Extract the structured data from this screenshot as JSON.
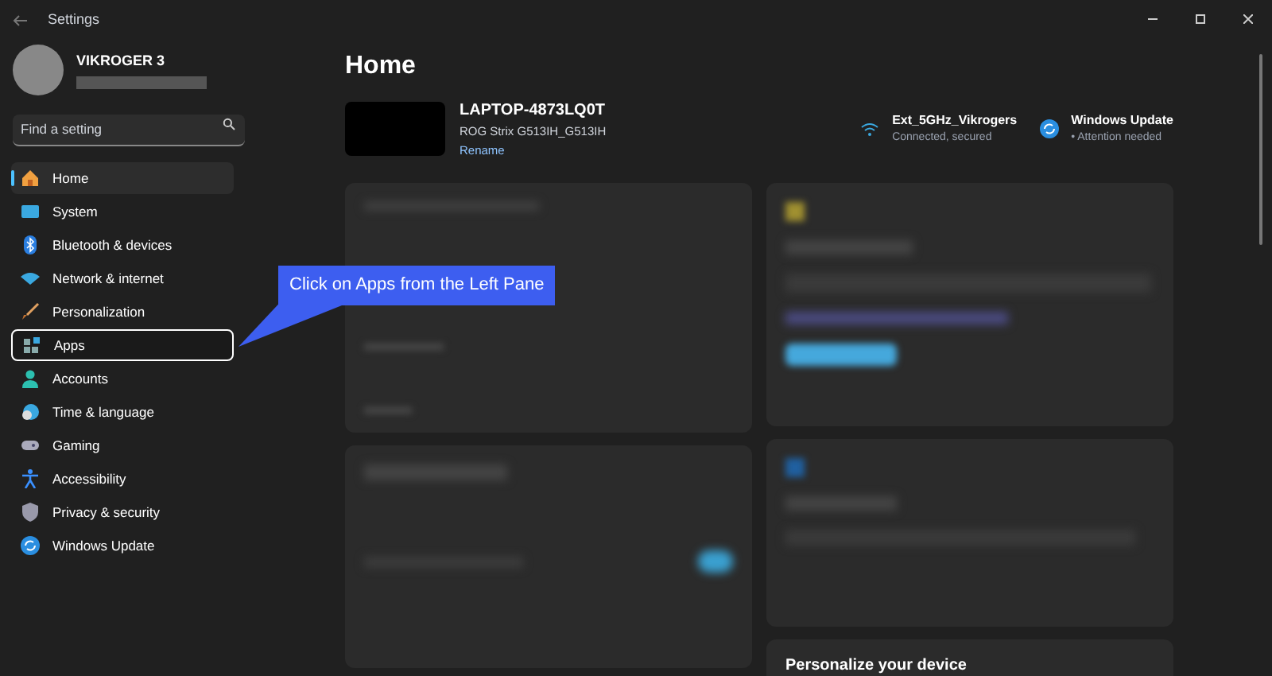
{
  "window": {
    "title": "Settings"
  },
  "user": {
    "name": "VIKROGER 3"
  },
  "search": {
    "placeholder": "Find a setting"
  },
  "nav": [
    {
      "label": "Home",
      "selected": true
    },
    {
      "label": "System",
      "selected": false
    },
    {
      "label": "Bluetooth & devices",
      "selected": false
    },
    {
      "label": "Network & internet",
      "selected": false
    },
    {
      "label": "Personalization",
      "selected": false
    },
    {
      "label": "Apps",
      "selected": false,
      "highlighted": true
    },
    {
      "label": "Accounts",
      "selected": false
    },
    {
      "label": "Time & language",
      "selected": false
    },
    {
      "label": "Gaming",
      "selected": false
    },
    {
      "label": "Accessibility",
      "selected": false
    },
    {
      "label": "Privacy & security",
      "selected": false
    },
    {
      "label": "Windows Update",
      "selected": false
    }
  ],
  "callout": {
    "text": "Click on Apps from the Left Pane"
  },
  "page": {
    "title": "Home",
    "device": {
      "name": "LAPTOP-4873LQ0T",
      "model": "ROG Strix G513IH_G513IH",
      "rename": "Rename"
    },
    "status": [
      {
        "title": "Ext_5GHz_Vikrogers",
        "subtitle": "Connected, secured"
      },
      {
        "title": "Windows Update",
        "subtitle": "• Attention needed"
      }
    ],
    "bottom_card_title": "Personalize your device"
  }
}
